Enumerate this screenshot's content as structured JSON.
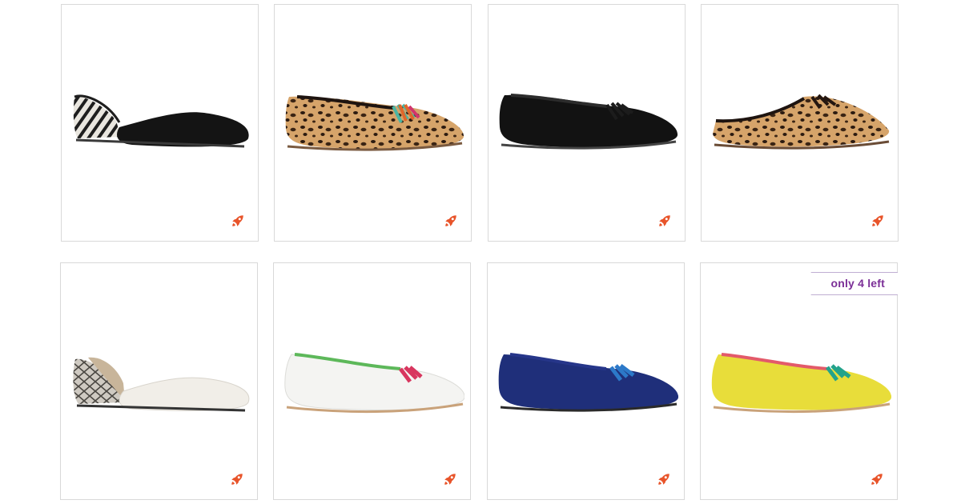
{
  "colors": {
    "border": "#d9d9d9",
    "rocket": "#e8542a",
    "badge_text": "#7b2f97"
  },
  "products": [
    {
      "name": "black-zebra-dorsay-flat",
      "icon": "rocket-icon"
    },
    {
      "name": "leopard-tassel-loafer",
      "icon": "rocket-icon"
    },
    {
      "name": "black-tassel-loafer",
      "icon": "rocket-icon"
    },
    {
      "name": "leopard-tassel-mule",
      "icon": "rocket-icon"
    },
    {
      "name": "white-snake-dorsay-flat",
      "icon": "rocket-icon"
    },
    {
      "name": "white-green-tassel-loafer",
      "icon": "rocket-icon"
    },
    {
      "name": "navy-tassel-loafer",
      "icon": "rocket-icon"
    },
    {
      "name": "yellow-pink-tassel-loafer",
      "icon": "rocket-icon",
      "badge": "only 4 left"
    }
  ]
}
